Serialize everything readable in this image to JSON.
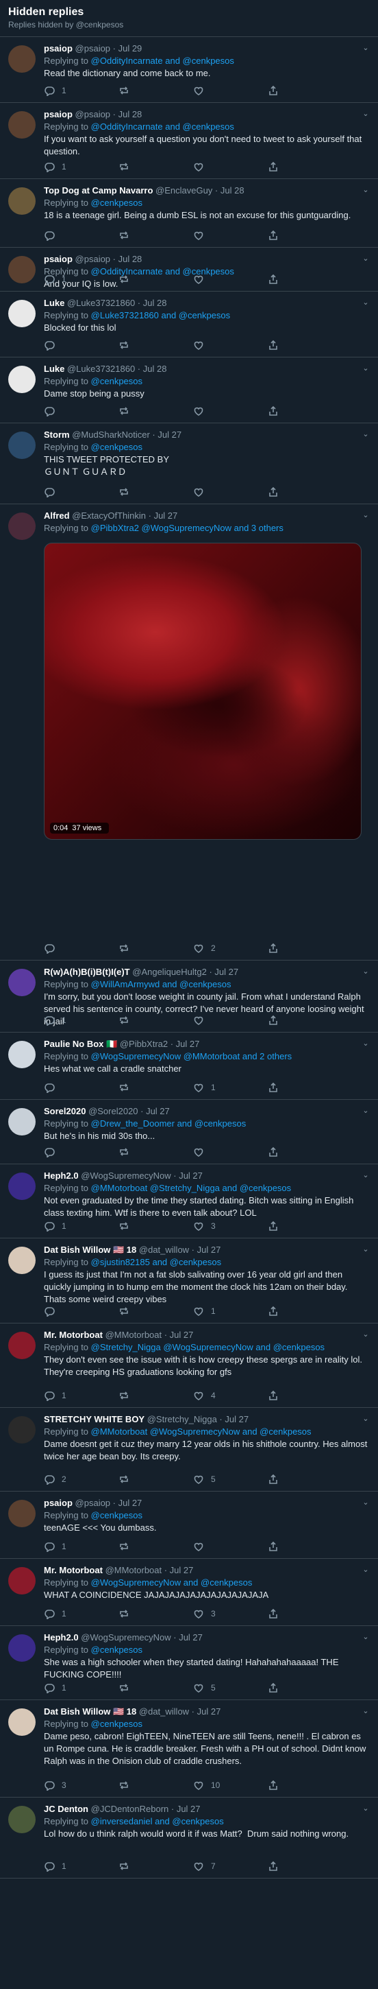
{
  "header": {
    "title": "Hidden replies",
    "subtitle": "Replies hidden by @cenkpesos"
  },
  "tweets": [
    {
      "name": "psaiop",
      "handle": "@psaiop · Jul 29",
      "replying_prefix": "Replying to ",
      "replying_to": "@OddityIncarnate and @cenkpesos",
      "text": "Read the dictionary and come back to me.",
      "replies": "1",
      "retweets": "",
      "likes": "",
      "avatar": "#5a4030"
    },
    {
      "name": "psaiop",
      "handle": "@psaiop · Jul 28",
      "replying_prefix": "Replying to ",
      "replying_to": "@OddityIncarnate and @cenkpesos",
      "text": "If you want to ask yourself a question you don't need to tweet to ask yourself that question.",
      "replies": "1",
      "retweets": "",
      "likes": "",
      "avatar": "#5a4030"
    },
    {
      "name": "Top Dog at Camp Navarro",
      "handle": "@EnclaveGuy · Jul 28",
      "replying_prefix": "Replying to ",
      "replying_to": "@cenkpesos",
      "text": "18 is a teenage girl. Being a dumb ESL is not an excuse for this guntguarding.",
      "replies": "",
      "retweets": "",
      "likes": "",
      "avatar": "#6b5a3a"
    },
    {
      "name": "psaiop",
      "handle": "@psaiop · Jul 28",
      "replying_prefix": "Replying to ",
      "replying_to": "@OddityIncarnate and @cenkpesos",
      "text": "And your IQ is low.",
      "replies": "1",
      "retweets": "",
      "likes": "",
      "avatar": "#5a4030"
    },
    {
      "name": "Luke",
      "handle": "@Luke37321860 · Jul 28",
      "replying_prefix": "Replying to ",
      "replying_to": "@Luke37321860 and @cenkpesos",
      "text": "Blocked for this lol",
      "replies": "",
      "retweets": "",
      "likes": "",
      "avatar": "#e8e8e8"
    },
    {
      "name": "Luke",
      "handle": "@Luke37321860 · Jul 28",
      "replying_prefix": "Replying to ",
      "replying_to": "@cenkpesos",
      "text": "Dame stop being a pussy",
      "replies": "",
      "retweets": "",
      "likes": "",
      "avatar": "#e8e8e8"
    },
    {
      "name": "Storm",
      "handle": "@MudSharkNoticer · Jul 27",
      "replying_prefix": "Replying to ",
      "replying_to": "@cenkpesos",
      "text": "THIS TWEET PROTECTED BY\nＧＵＮＴ ＧＵＡＲＤ",
      "replies": "",
      "retweets": "",
      "likes": "",
      "avatar": "#2a4a6a"
    },
    {
      "name": "Alfred",
      "handle": "@ExtacyOfThinkin · Jul 27",
      "replying_prefix": "Replying to ",
      "replying_to": "@PibbXtra2 @WogSupremecyNow and 3 others",
      "text": "",
      "video": {
        "duration": "0:04",
        "views": "37 views"
      },
      "replies": "",
      "retweets": "",
      "likes": "2",
      "avatar": "#4a2a3a"
    },
    {
      "name": "R(w)A(h)B(i)B(t)I(e)T",
      "handle": "@AngeliqueHultg2 · Jul 27",
      "replying_prefix": "Replying to ",
      "replying_to": "@WillAmArmywd and @cenkpesos",
      "text": "I'm sorry, but you don't loose weight in county jail. From what I understand Ralph served his sentence in county, correct? I've never heard of anyone loosing weight in jail",
      "replies": "1",
      "retweets": "",
      "likes": "",
      "avatar": "#5b3aa0"
    },
    {
      "name": "Paulie No Box 🇮🇹",
      "handle": "@PibbXtra2 · Jul 27",
      "replying_prefix": "Replying to ",
      "replying_to": "@WogSupremecyNow @MMotorboat and 2 others",
      "text": "Hes what we call a cradle snatcher",
      "replies": "",
      "retweets": "",
      "likes": "1",
      "avatar": "#d0d8e0"
    },
    {
      "name": "Sorel2020",
      "handle": "@Sorel2020 · Jul 27",
      "replying_prefix": "Replying to ",
      "replying_to": "@Drew_the_Doomer and @cenkpesos",
      "text": "But he's in his mid 30s tho...",
      "replies": "",
      "retweets": "",
      "likes": "",
      "avatar": "#c8d0d8"
    },
    {
      "name": "Heph2.0",
      "handle": "@WogSupremecyNow · Jul 27",
      "replying_prefix": "Replying to ",
      "replying_to": "@MMotorboat @Stretchy_Nigga and @cenkpesos",
      "text": "Not even graduated by the time they started dating. Bitch was sitting in English class texting him. Wtf is there to even talk about? LOL",
      "replies": "1",
      "retweets": "",
      "likes": "3",
      "avatar": "#3a2a8a"
    },
    {
      "name": "Dat Bish Willow 🇺🇸 18",
      "handle": "@dat_willow · Jul 27",
      "replying_prefix": "Replying to ",
      "replying_to": "@sjustin82185 and @cenkpesos",
      "text": "I guess its just that I'm not a fat slob salivating over 16 year old girl and then quickly jumping in to hump em the moment the clock hits 12am on their bday. Thats some weird creepy vibes",
      "replies": "",
      "retweets": "",
      "likes": "1",
      "avatar": "#d8c8b8"
    },
    {
      "name": "Mr. Motorboat",
      "handle": "@MMotorboat · Jul 27",
      "replying_prefix": "Replying to ",
      "replying_to": "@Stretchy_Nigga @WogSupremecyNow and @cenkpesos",
      "text": "They don't even see the issue with it is how creepy these spergs are in reality lol. They're creeping HS graduations looking for gfs",
      "replies": "1",
      "retweets": "",
      "likes": "4",
      "avatar": "#8a1a2a"
    },
    {
      "name": "STRETCHY WHITE BOY",
      "handle": "@Stretchy_Nigga · Jul 27",
      "replying_prefix": "Replying to ",
      "replying_to": "@MMotorboat @WogSupremecyNow and @cenkpesos",
      "text": "Dame doesnt get it cuz they marry 12 year olds in his shithole country. Hes almost twice her age bean boy. Its creepy.",
      "replies": "2",
      "retweets": "",
      "likes": "5",
      "avatar": "#2a2a2a"
    },
    {
      "name": "psaiop",
      "handle": "@psaiop · Jul 27",
      "replying_prefix": "Replying to ",
      "replying_to": "@cenkpesos",
      "text": "teenAGE <<< You dumbass.",
      "replies": "1",
      "retweets": "",
      "likes": "",
      "avatar": "#5a4030"
    },
    {
      "name": "Mr. Motorboat",
      "handle": "@MMotorboat · Jul 27",
      "replying_prefix": "Replying to ",
      "replying_to": "@WogSupremecyNow and @cenkpesos",
      "text": "WHAT A COINCIDENCE JAJAJAJAJAJAJAJAJAJAJAJA",
      "replies": "1",
      "retweets": "",
      "likes": "3",
      "avatar": "#8a1a2a"
    },
    {
      "name": "Heph2.0",
      "handle": "@WogSupremecyNow · Jul 27",
      "replying_prefix": "Replying to ",
      "replying_to": "@cenkpesos",
      "text": "She was a high schooler when they started dating! Hahahahahaaaaa! THE FUCKING COPE!!!!",
      "replies": "1",
      "retweets": "",
      "likes": "5",
      "avatar": "#3a2a8a"
    },
    {
      "name": "Dat Bish Willow 🇺🇸 18",
      "handle": "@dat_willow · Jul 27",
      "replying_prefix": "Replying to ",
      "replying_to": "@cenkpesos",
      "text": "Dame peso, cabron! EighTEEN, NineTEEN are still Teens, nene!!! . El cabron es un Rompe cuna. He is craddle breaker. Fresh with a PH out of school. Didnt know Ralph was in the Onision club of craddle crushers.",
      "replies": "3",
      "retweets": "",
      "likes": "10",
      "avatar": "#d8c8b8"
    },
    {
      "name": "JC Denton",
      "handle": "@JCDentonReborn · Jul 27",
      "replying_prefix": "Replying to ",
      "replying_to": "@inversedaniel and @cenkpesos",
      "text": "Lol how do u think ralph would word it if was Matt?  Drum said nothing wrong.",
      "replies": "1",
      "retweets": "",
      "likes": "7",
      "avatar": "#4a5a3a"
    }
  ]
}
